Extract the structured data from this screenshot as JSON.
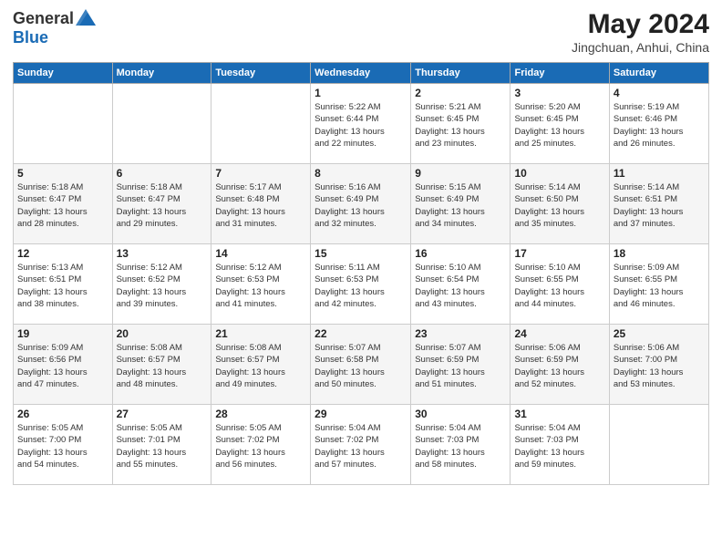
{
  "logo": {
    "general": "General",
    "blue": "Blue"
  },
  "title": "May 2024",
  "location": "Jingchuan, Anhui, China",
  "days_header": [
    "Sunday",
    "Monday",
    "Tuesday",
    "Wednesday",
    "Thursday",
    "Friday",
    "Saturday"
  ],
  "weeks": [
    [
      {
        "day": "",
        "info": ""
      },
      {
        "day": "",
        "info": ""
      },
      {
        "day": "",
        "info": ""
      },
      {
        "day": "1",
        "info": "Sunrise: 5:22 AM\nSunset: 6:44 PM\nDaylight: 13 hours\nand 22 minutes."
      },
      {
        "day": "2",
        "info": "Sunrise: 5:21 AM\nSunset: 6:45 PM\nDaylight: 13 hours\nand 23 minutes."
      },
      {
        "day": "3",
        "info": "Sunrise: 5:20 AM\nSunset: 6:45 PM\nDaylight: 13 hours\nand 25 minutes."
      },
      {
        "day": "4",
        "info": "Sunrise: 5:19 AM\nSunset: 6:46 PM\nDaylight: 13 hours\nand 26 minutes."
      }
    ],
    [
      {
        "day": "5",
        "info": "Sunrise: 5:18 AM\nSunset: 6:47 PM\nDaylight: 13 hours\nand 28 minutes."
      },
      {
        "day": "6",
        "info": "Sunrise: 5:18 AM\nSunset: 6:47 PM\nDaylight: 13 hours\nand 29 minutes."
      },
      {
        "day": "7",
        "info": "Sunrise: 5:17 AM\nSunset: 6:48 PM\nDaylight: 13 hours\nand 31 minutes."
      },
      {
        "day": "8",
        "info": "Sunrise: 5:16 AM\nSunset: 6:49 PM\nDaylight: 13 hours\nand 32 minutes."
      },
      {
        "day": "9",
        "info": "Sunrise: 5:15 AM\nSunset: 6:49 PM\nDaylight: 13 hours\nand 34 minutes."
      },
      {
        "day": "10",
        "info": "Sunrise: 5:14 AM\nSunset: 6:50 PM\nDaylight: 13 hours\nand 35 minutes."
      },
      {
        "day": "11",
        "info": "Sunrise: 5:14 AM\nSunset: 6:51 PM\nDaylight: 13 hours\nand 37 minutes."
      }
    ],
    [
      {
        "day": "12",
        "info": "Sunrise: 5:13 AM\nSunset: 6:51 PM\nDaylight: 13 hours\nand 38 minutes."
      },
      {
        "day": "13",
        "info": "Sunrise: 5:12 AM\nSunset: 6:52 PM\nDaylight: 13 hours\nand 39 minutes."
      },
      {
        "day": "14",
        "info": "Sunrise: 5:12 AM\nSunset: 6:53 PM\nDaylight: 13 hours\nand 41 minutes."
      },
      {
        "day": "15",
        "info": "Sunrise: 5:11 AM\nSunset: 6:53 PM\nDaylight: 13 hours\nand 42 minutes."
      },
      {
        "day": "16",
        "info": "Sunrise: 5:10 AM\nSunset: 6:54 PM\nDaylight: 13 hours\nand 43 minutes."
      },
      {
        "day": "17",
        "info": "Sunrise: 5:10 AM\nSunset: 6:55 PM\nDaylight: 13 hours\nand 44 minutes."
      },
      {
        "day": "18",
        "info": "Sunrise: 5:09 AM\nSunset: 6:55 PM\nDaylight: 13 hours\nand 46 minutes."
      }
    ],
    [
      {
        "day": "19",
        "info": "Sunrise: 5:09 AM\nSunset: 6:56 PM\nDaylight: 13 hours\nand 47 minutes."
      },
      {
        "day": "20",
        "info": "Sunrise: 5:08 AM\nSunset: 6:57 PM\nDaylight: 13 hours\nand 48 minutes."
      },
      {
        "day": "21",
        "info": "Sunrise: 5:08 AM\nSunset: 6:57 PM\nDaylight: 13 hours\nand 49 minutes."
      },
      {
        "day": "22",
        "info": "Sunrise: 5:07 AM\nSunset: 6:58 PM\nDaylight: 13 hours\nand 50 minutes."
      },
      {
        "day": "23",
        "info": "Sunrise: 5:07 AM\nSunset: 6:59 PM\nDaylight: 13 hours\nand 51 minutes."
      },
      {
        "day": "24",
        "info": "Sunrise: 5:06 AM\nSunset: 6:59 PM\nDaylight: 13 hours\nand 52 minutes."
      },
      {
        "day": "25",
        "info": "Sunrise: 5:06 AM\nSunset: 7:00 PM\nDaylight: 13 hours\nand 53 minutes."
      }
    ],
    [
      {
        "day": "26",
        "info": "Sunrise: 5:05 AM\nSunset: 7:00 PM\nDaylight: 13 hours\nand 54 minutes."
      },
      {
        "day": "27",
        "info": "Sunrise: 5:05 AM\nSunset: 7:01 PM\nDaylight: 13 hours\nand 55 minutes."
      },
      {
        "day": "28",
        "info": "Sunrise: 5:05 AM\nSunset: 7:02 PM\nDaylight: 13 hours\nand 56 minutes."
      },
      {
        "day": "29",
        "info": "Sunrise: 5:04 AM\nSunset: 7:02 PM\nDaylight: 13 hours\nand 57 minutes."
      },
      {
        "day": "30",
        "info": "Sunrise: 5:04 AM\nSunset: 7:03 PM\nDaylight: 13 hours\nand 58 minutes."
      },
      {
        "day": "31",
        "info": "Sunrise: 5:04 AM\nSunset: 7:03 PM\nDaylight: 13 hours\nand 59 minutes."
      },
      {
        "day": "",
        "info": ""
      }
    ]
  ]
}
